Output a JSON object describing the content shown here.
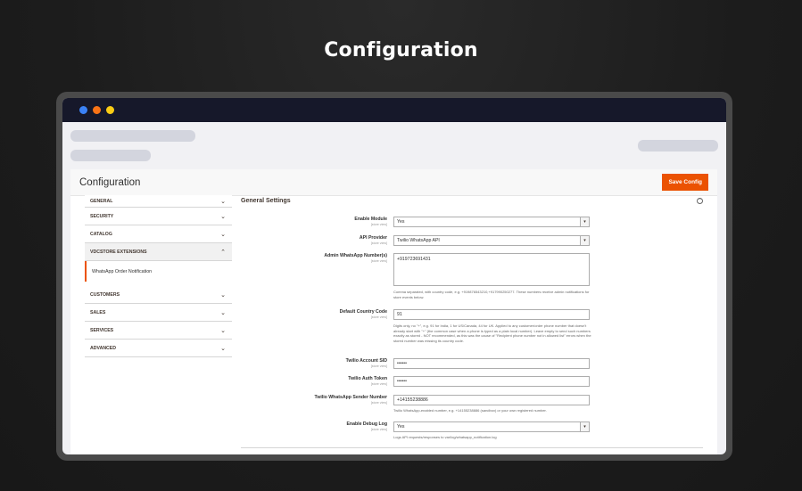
{
  "hero": {
    "title": "Configuration"
  },
  "window": {
    "dots": [
      {
        "color": "#3b82f6"
      },
      {
        "color": "#f97316"
      },
      {
        "color": "#facc15"
      }
    ]
  },
  "page": {
    "title": "Configuration",
    "save_label": "Save Config",
    "accent": "#eb5202"
  },
  "sidebar": {
    "items": [
      {
        "label": "GENERAL"
      },
      {
        "label": "SECURITY"
      },
      {
        "label": "CATALOG"
      },
      {
        "label": "VDCSTORE EXTENSIONS",
        "open": true,
        "sub": "WhatsApp Order Notification"
      },
      {
        "label": "CUSTOMERS"
      },
      {
        "label": "SALES"
      },
      {
        "label": "SERVICES"
      },
      {
        "label": "ADVANCED"
      }
    ]
  },
  "settings": {
    "section_title": "General Settings",
    "scope": "[store view]",
    "fields": {
      "enable_module": {
        "label": "Enable Module",
        "value": "Yes"
      },
      "api_provider": {
        "label": "API Provider",
        "value": "Twilio WhatsApp API"
      },
      "admin_numbers": {
        "label": "Admin WhatsApp Number(s)",
        "value": "+919723691431",
        "note": "Comma separated, with country code, e.g. +919876543210,+917990250277. These numbers receive admin notifications for store events below."
      },
      "country_code": {
        "label": "Default Country Code",
        "value": "91",
        "note": "Digits only, no \"+\", e.g. 91 for India, 1 for US/Canada, 44 for UK. Applied to any customer/order phone number that doesn't already start with \"+\" (the common case when a phone is typed as a plain local number). Leave empty to send such numbers exactly as stored - NOT recommended, as this was the cause of \"Recipient phone number not in allowed list\" errors when the stored number was missing its country code."
      },
      "account_sid": {
        "label": "Twilio Account SID",
        "value": "••••••"
      },
      "auth_token": {
        "label": "Twilio Auth Token",
        "value": "••••••"
      },
      "sender_number": {
        "label": "Twilio WhatsApp Sender Number",
        "value": "+14155238886",
        "note": "Twilio WhatsApp-enabled number, e.g. +14155238886 (sandbox) or your own registered number."
      },
      "debug_log": {
        "label": "Enable Debug Log",
        "value": "Yes",
        "note": "Logs API requests/responses to var/log/whatsapp_notification.log"
      }
    }
  }
}
